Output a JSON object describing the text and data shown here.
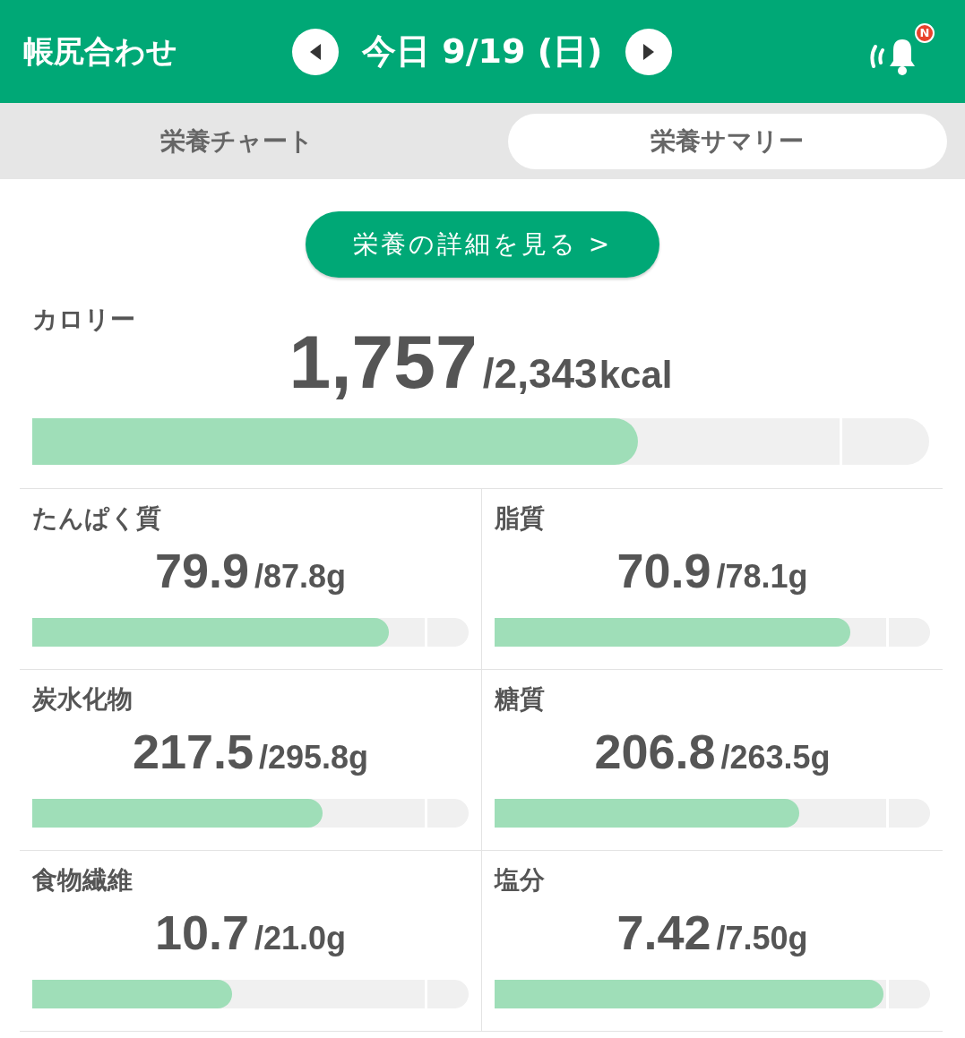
{
  "header": {
    "title": "帳尻合わせ",
    "date": "今日 9/19 (日)",
    "notification_badge": "N"
  },
  "tabs": [
    {
      "label": "栄養チャート",
      "selected": false
    },
    {
      "label": "栄養サマリー",
      "selected": true
    }
  ],
  "detail_button": "栄養の詳細を見る >",
  "calorie": {
    "label": "カロリー",
    "value": "1,757",
    "target": "/2,343",
    "unit": "kcal",
    "level": 0.675
  },
  "nutrients": [
    {
      "label": "たんぱく質",
      "value": "79.9",
      "target": "/87.8g",
      "level": 0.817
    },
    {
      "label": "脂質",
      "value": "70.9",
      "target": "/78.1g",
      "level": 0.817
    },
    {
      "label": "炭水化物",
      "value": "217.5",
      "target": "/295.8g",
      "level": 0.665
    },
    {
      "label": "糖質",
      "value": "206.8",
      "target": "/263.5g",
      "level": 0.7
    },
    {
      "label": "食物繊維",
      "value": "10.7",
      "target": "/21.0g",
      "level": 0.458
    },
    {
      "label": "塩分",
      "value": "7.42",
      "target": "/7.50g",
      "level": 0.893
    }
  ]
}
